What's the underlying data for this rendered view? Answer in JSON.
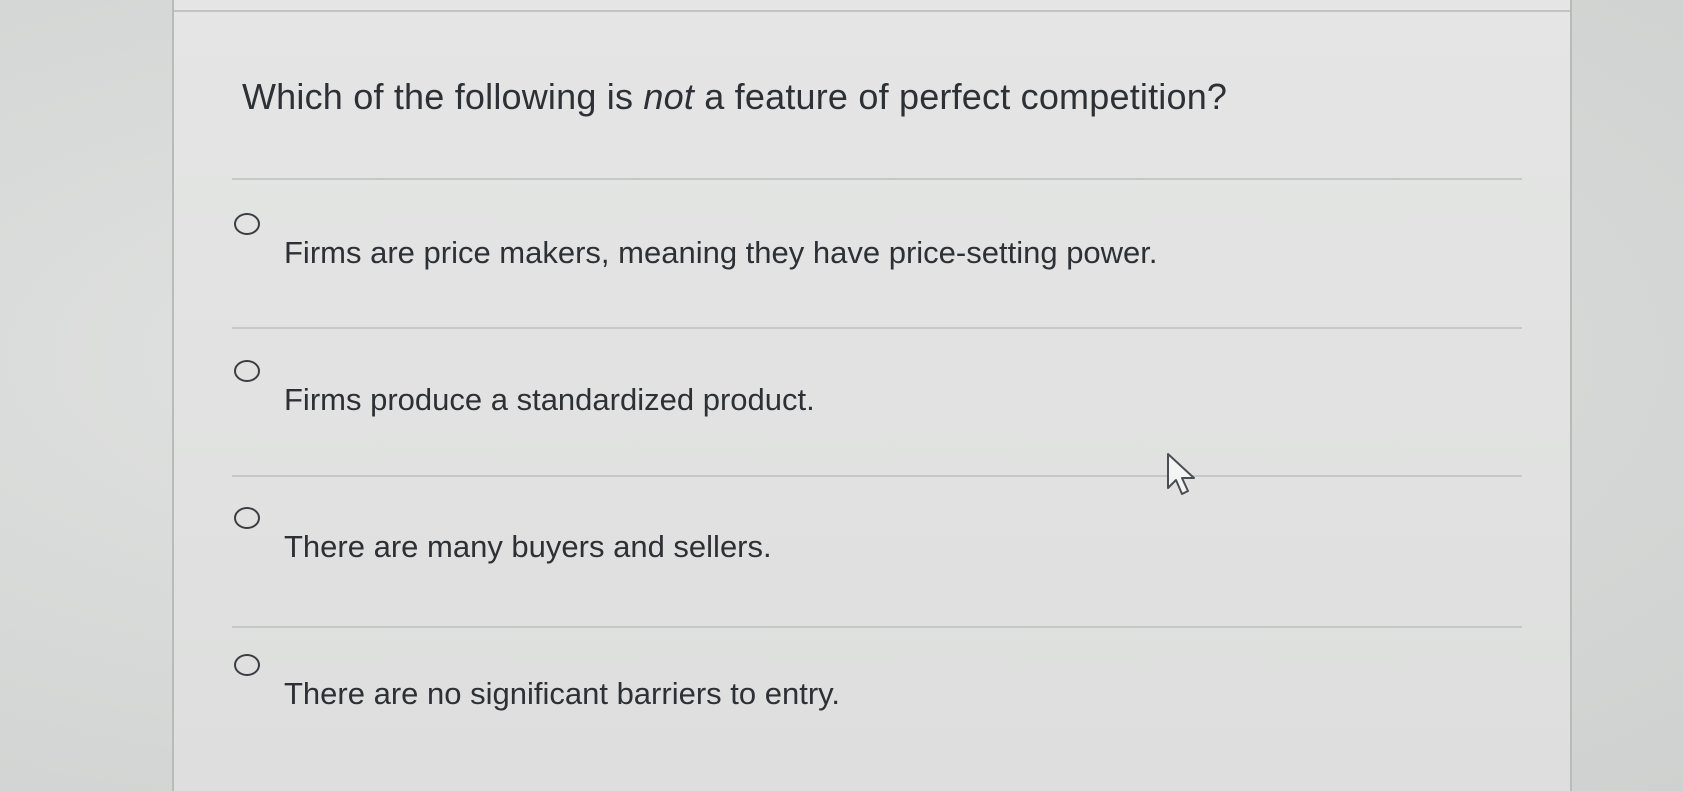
{
  "question": {
    "prefix": "Which of the following is ",
    "emphasis": "not",
    "suffix": " a feature of perfect competition?"
  },
  "options": [
    {
      "label": "Firms are price makers, meaning they have price-setting power.",
      "selected": false
    },
    {
      "label": "Firms produce a standardized product.",
      "selected": false
    },
    {
      "label": "There are many buyers and sellers.",
      "selected": false
    },
    {
      "label": "There are no significant barriers to entry.",
      "selected": false
    }
  ],
  "icons": {
    "radio": "radio-unselected-icon",
    "cursor": "mouse-pointer-icon"
  },
  "colors": {
    "text": "#2d3034",
    "background": "#e2e3e2",
    "divider": "#c6c8c7"
  }
}
